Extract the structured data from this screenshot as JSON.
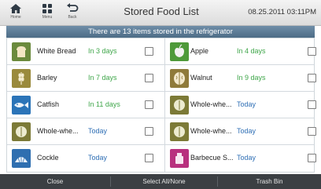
{
  "header": {
    "home_label": "Home",
    "menu_label": "Menu",
    "back_label": "Back",
    "title": "Stored Food List",
    "datetime": "08.25.2011 03:11PM"
  },
  "banner": "There are 13 items stored in the refrigerator",
  "rows": [
    {
      "left": {
        "name": "White Bread",
        "days": "In 3 days",
        "days_color": "green",
        "icon": "bread-icon"
      },
      "right": {
        "name": "Apple",
        "days": "In 4 days",
        "days_color": "green",
        "icon": "apple-icon"
      }
    },
    {
      "left": {
        "name": "Barley",
        "days": "In 7 days",
        "days_color": "green",
        "icon": "barley-icon"
      },
      "right": {
        "name": "Walnut",
        "days": "In 9 days",
        "days_color": "green",
        "icon": "walnut-icon"
      }
    },
    {
      "left": {
        "name": "Catfish",
        "days": "In 11 days",
        "days_color": "green",
        "icon": "fish-icon"
      },
      "right": {
        "name": "Whole-whe...",
        "days": "Today",
        "days_color": "blue",
        "icon": "grain-icon"
      }
    },
    {
      "left": {
        "name": "Whole-whe...",
        "days": "Today",
        "days_color": "blue",
        "icon": "grain-icon"
      },
      "right": {
        "name": "Whole-whe...",
        "days": "Today",
        "days_color": "blue",
        "icon": "grain-icon"
      }
    },
    {
      "left": {
        "name": "Cockle",
        "days": "Today",
        "days_color": "blue",
        "icon": "shell-icon"
      },
      "right": {
        "name": "Barbecue S...",
        "days": "Today",
        "days_color": "blue",
        "icon": "barbecue-icon"
      }
    }
  ],
  "footer": {
    "close_label": "Close",
    "select_label": "Select All/None",
    "trash_label": "Trash Bin"
  },
  "colors": {
    "green_text": "#3fa64a",
    "blue_text": "#2f6fb5",
    "banner": "#5a7a94",
    "footer": "#3b3f43"
  }
}
